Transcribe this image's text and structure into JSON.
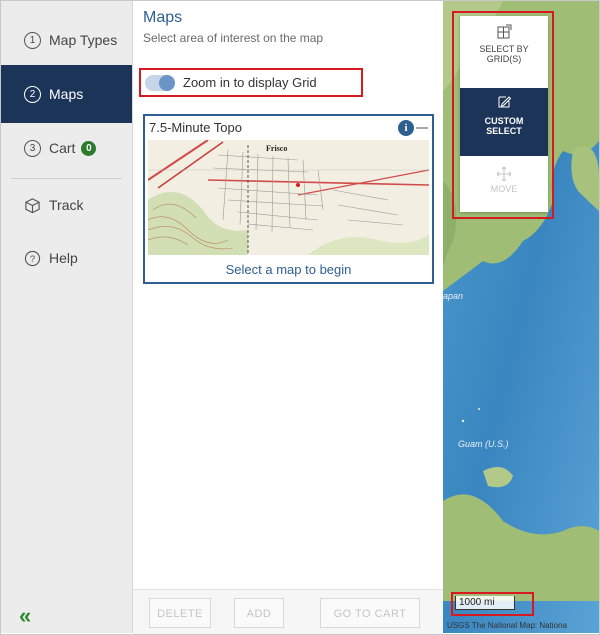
{
  "sidebar": {
    "items": [
      {
        "num": "1",
        "label": "Map Types"
      },
      {
        "num": "2",
        "label": "Maps"
      },
      {
        "num": "3",
        "label": "Cart",
        "badge": "0"
      },
      {
        "label": "Track",
        "icon": "box-icon"
      },
      {
        "label": "Help",
        "icon": "help-circle-icon"
      }
    ],
    "collapse_label": "«"
  },
  "panel": {
    "title": "Maps",
    "subtitle": "Select area of interest on the map",
    "zoom_toggle_label": "Zoom in to display Grid",
    "card": {
      "title": "7.5-Minute Topo",
      "info": "i",
      "footer": "Select a map to begin",
      "thumb_label": "Frisco"
    },
    "buttons": {
      "delete": "DELETE",
      "add": "ADD",
      "go_to_cart": "GO TO CART"
    }
  },
  "map": {
    "tools": {
      "select_by_grid": "SELECT BY GRID(S)",
      "custom_select_line1": "CUSTOM",
      "custom_select_line2": "SELECT",
      "move": "MOVE"
    },
    "labels": {
      "japan": "apan",
      "guam": "Guam (U.S.)"
    },
    "scale": "1000 mi",
    "attribution": "USGS The National Map: Nationa"
  },
  "colors": {
    "nav_active": "#1c3458",
    "accent": "#2f5f91",
    "highlight": "#d71921",
    "badge": "#2d7b2e",
    "ocean": "#3f8fc7",
    "land": "#9fbd74"
  }
}
